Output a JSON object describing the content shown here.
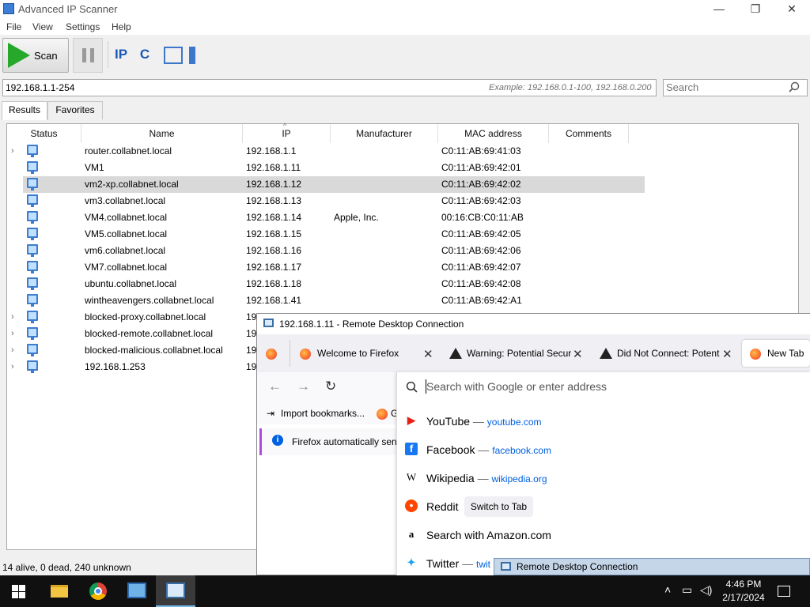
{
  "window": {
    "title": "Advanced IP Scanner"
  },
  "menu": [
    "File",
    "View",
    "Settings",
    "Help"
  ],
  "toolbar": {
    "scan_label": "Scan",
    "ip_icon": "IP",
    "c_icon": "C"
  },
  "range": {
    "value": "192.168.1.1-254",
    "example": "Example: 192.168.0.1-100, 192.168.0.200"
  },
  "search": {
    "placeholder": "Search"
  },
  "tabs": [
    "Results",
    "Favorites"
  ],
  "columns": [
    "Status",
    "Name",
    "IP",
    "Manufacturer",
    "MAC address",
    "Comments"
  ],
  "rows": [
    {
      "name": "router.collabnet.local",
      "ip": "192.168.1.1",
      "manufacturer": "",
      "mac": "C0:11:AB:69:41:03",
      "expandable": true
    },
    {
      "name": "VM1",
      "ip": "192.168.1.11",
      "manufacturer": "",
      "mac": "C0:11:AB:69:42:01",
      "expandable": false
    },
    {
      "name": "vm2-xp.collabnet.local",
      "ip": "192.168.1.12",
      "manufacturer": "",
      "mac": "C0:11:AB:69:42:02",
      "expandable": false,
      "selected": true
    },
    {
      "name": "vm3.collabnet.local",
      "ip": "192.168.1.13",
      "manufacturer": "",
      "mac": "C0:11:AB:69:42:03",
      "expandable": false
    },
    {
      "name": "VM4.collabnet.local",
      "ip": "192.168.1.14",
      "manufacturer": "Apple, Inc.",
      "mac": "00:16:CB:C0:11:AB",
      "expandable": false
    },
    {
      "name": "VM5.collabnet.local",
      "ip": "192.168.1.15",
      "manufacturer": "",
      "mac": "C0:11:AB:69:42:05",
      "expandable": false
    },
    {
      "name": "vm6.collabnet.local",
      "ip": "192.168.1.16",
      "manufacturer": "",
      "mac": "C0:11:AB:69:42:06",
      "expandable": false
    },
    {
      "name": "VM7.collabnet.local",
      "ip": "192.168.1.17",
      "manufacturer": "",
      "mac": "C0:11:AB:69:42:07",
      "expandable": false
    },
    {
      "name": "ubuntu.collabnet.local",
      "ip": "192.168.1.18",
      "manufacturer": "",
      "mac": "C0:11:AB:69:42:08",
      "expandable": false
    },
    {
      "name": "wintheavengers.collabnet.local",
      "ip": "192.168.1.41",
      "manufacturer": "",
      "mac": "C0:11:AB:69:42:A1",
      "expandable": false
    },
    {
      "name": "blocked-proxy.collabnet.local",
      "ip": "19",
      "manufacturer": "",
      "mac": "",
      "expandable": true
    },
    {
      "name": "blocked-remote.collabnet.local",
      "ip": "19",
      "manufacturer": "",
      "mac": "",
      "expandable": true
    },
    {
      "name": "blocked-malicious.collabnet.local",
      "ip": "19",
      "manufacturer": "",
      "mac": "",
      "expandable": true
    },
    {
      "name": "192.168.1.253",
      "ip": "19",
      "manufacturer": "",
      "mac": "",
      "expandable": true
    }
  ],
  "status": "14 alive, 0 dead, 240 unknown",
  "rdp": {
    "title": "192.168.1.11 - Remote Desktop Connection",
    "tabs": [
      "Welcome to Firefox",
      "Warning: Potential Secur",
      "Did Not Connect: Potent",
      "New Tab"
    ],
    "bookmarks_label": "Import bookmarks...",
    "bookmark_extra": "G",
    "info_text": "Firefox automatically sen",
    "url_placeholder": "Search with Google or enter address",
    "suggestions": [
      {
        "title": "YouTube",
        "sep": "—",
        "url": "youtube.com",
        "icon": "youtube-icon"
      },
      {
        "title": "Facebook",
        "sep": "—",
        "url": "facebook.com",
        "icon": "facebook-icon"
      },
      {
        "title": "Wikipedia",
        "sep": "—",
        "url": "wikipedia.org",
        "icon": "wikipedia-icon"
      },
      {
        "title": "Reddit",
        "sep": "",
        "url": "",
        "icon": "reddit-icon"
      },
      {
        "title": "Search with Amazon.com",
        "sep": "",
        "url": "",
        "icon": "amazon-icon"
      },
      {
        "title": "Twitter",
        "sep": "—",
        "url": "twit",
        "icon": "twitter-icon"
      }
    ],
    "switch_tab": "Switch to Tab",
    "mini_title": "Remote Desktop Connection"
  },
  "taskbar": {
    "time": "4:46 PM",
    "date": "2/17/2024"
  },
  "colors": {
    "accent": "#0061e0",
    "scan_green": "#26a82a",
    "selection": "#d9d9d9"
  }
}
